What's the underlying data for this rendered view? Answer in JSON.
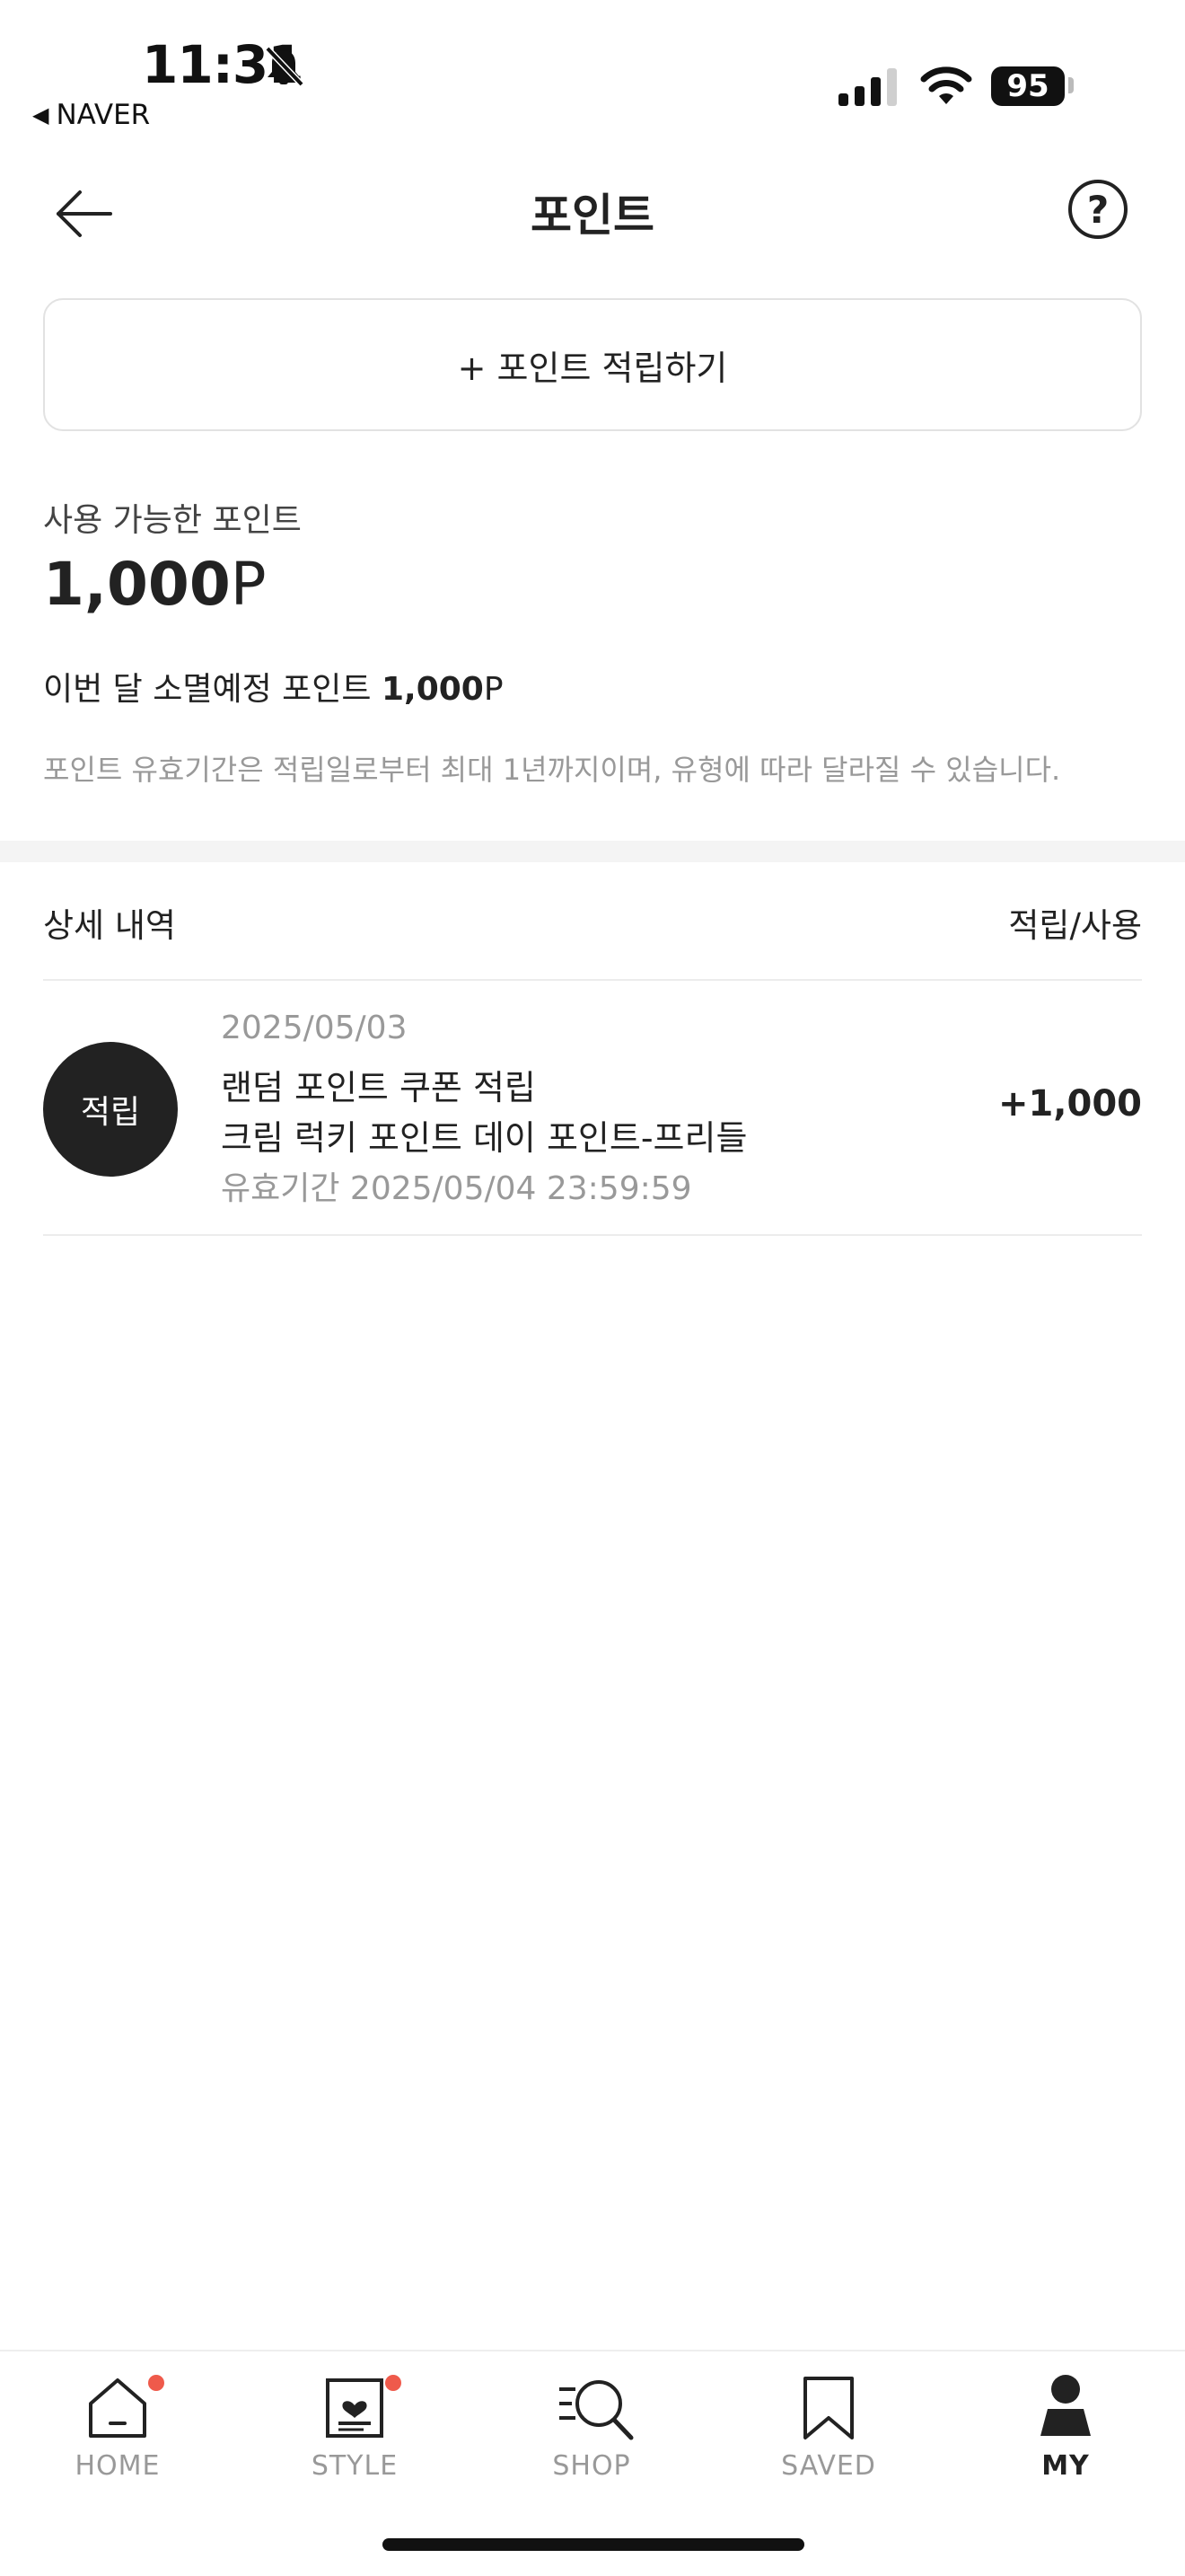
{
  "status_bar": {
    "time": "11:31",
    "back_app": "NAVER",
    "battery": "95"
  },
  "header": {
    "title": "포인트",
    "help_label": "?"
  },
  "earn_button": {
    "label": "+ 포인트 적립하기"
  },
  "balance": {
    "label": "사용 가능한 포인트",
    "amount": "1,000",
    "unit": "P"
  },
  "expire": {
    "prefix": "이번 달 소멸예정 포인트 ",
    "amount": "1,000",
    "unit": "P"
  },
  "notice": "포인트 유효기간은 적립일로부터 최대 1년까지이며, 유형에 따라 달라질 수 있습니다.",
  "history": {
    "title": "상세 내역",
    "filter_label": "적립/사용",
    "items": [
      {
        "badge": "적립",
        "date": "2025/05/03",
        "title": "랜덤 포인트 쿠폰 적립",
        "subtitle": "크림 럭키 포인트 데이 포인트-프리들",
        "expiry": "유효기간 2025/05/04 23:59:59",
        "amount": "+1,000"
      }
    ]
  },
  "bottom_nav": {
    "items": [
      {
        "label": "HOME",
        "icon": "home-icon",
        "badge_dot": true,
        "active": false
      },
      {
        "label": "STYLE",
        "icon": "style-icon",
        "badge_dot": true,
        "active": false
      },
      {
        "label": "SHOP",
        "icon": "shop-search-icon",
        "badge_dot": false,
        "active": false
      },
      {
        "label": "SAVED",
        "icon": "bookmark-icon",
        "badge_dot": false,
        "active": false
      },
      {
        "label": "MY",
        "icon": "person-icon",
        "badge_dot": false,
        "active": true
      }
    ]
  },
  "colors": {
    "text_primary": "#222222",
    "text_secondary": "#999999",
    "badge_bg": "#222222",
    "notification_dot": "#ef5a4b",
    "divider": "#f4f4f4"
  }
}
